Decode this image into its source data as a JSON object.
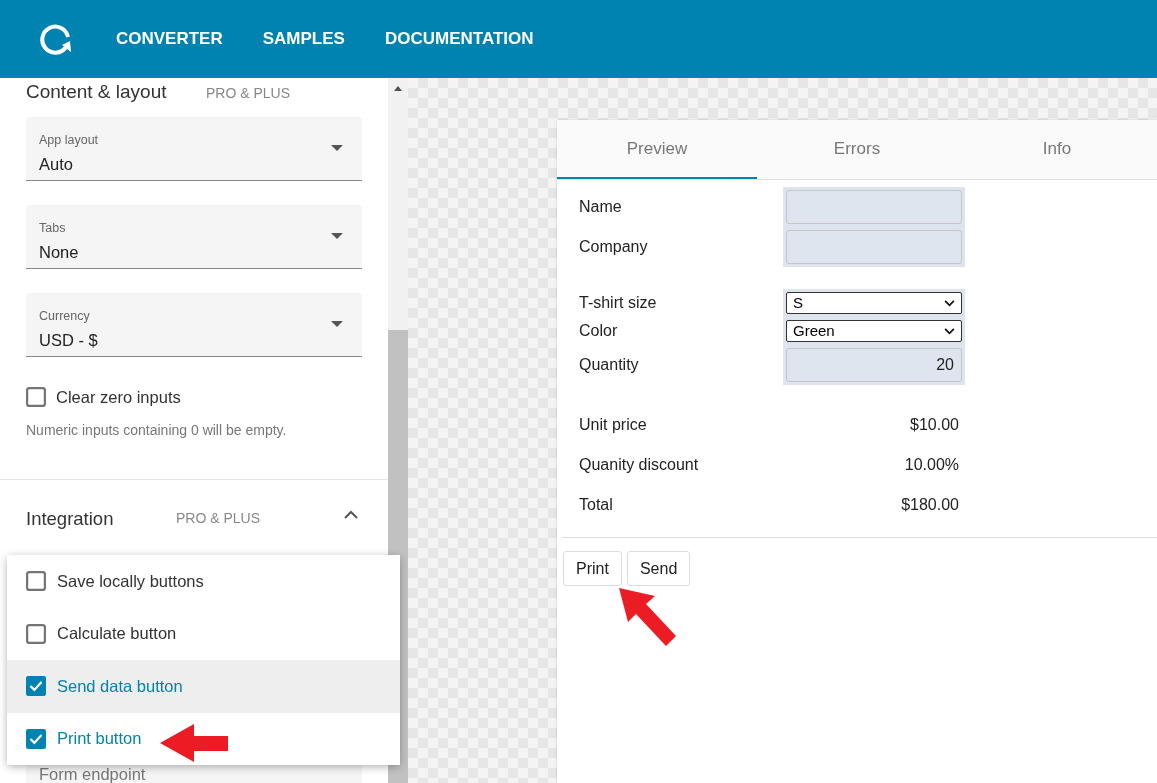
{
  "header": {
    "nav": [
      "CONVERTER",
      "SAMPLES",
      "DOCUMENTATION"
    ]
  },
  "sidebar": {
    "section_title": "Content & layout",
    "section_badge": "PRO & PLUS",
    "selects": [
      {
        "label": "App layout",
        "value": "Auto"
      },
      {
        "label": "Tabs",
        "value": "None"
      },
      {
        "label": "Currency",
        "value": "USD - $"
      }
    ],
    "checkbox": {
      "label": "Clear zero inputs",
      "checked": false
    },
    "helper": "Numeric inputs containing 0 will be empty.",
    "integration": {
      "title": "Integration",
      "badge": "PRO & PLUS",
      "expanded": true
    },
    "menu": [
      {
        "label": "Save locally buttons",
        "checked": false,
        "highlighted": false
      },
      {
        "label": "Calculate button",
        "checked": false,
        "highlighted": false
      },
      {
        "label": "Send data button",
        "checked": true,
        "highlighted": true
      },
      {
        "label": "Print button",
        "checked": true,
        "highlighted": false
      }
    ],
    "field_label": "Form endpoint"
  },
  "preview": {
    "tabs": [
      {
        "label": "Preview",
        "selected": true
      },
      {
        "label": "Errors",
        "selected": false
      },
      {
        "label": "Info",
        "selected": false
      }
    ],
    "field_groups": [
      [
        {
          "label": "Name",
          "kind": "text"
        },
        {
          "label": "Company",
          "kind": "text"
        }
      ],
      [
        {
          "label": "T-shirt size",
          "kind": "select",
          "value": "S"
        },
        {
          "label": "Color",
          "kind": "select",
          "value": "Green"
        },
        {
          "label": "Quantity",
          "kind": "number",
          "value": "20"
        }
      ]
    ],
    "totals": [
      {
        "label": "Unit price",
        "value": "$10.00"
      },
      {
        "label": "Quanity discount",
        "value": "10.00%"
      },
      {
        "label": "Total",
        "value": "$180.00"
      }
    ],
    "buttons": [
      "Print",
      "Send"
    ]
  }
}
